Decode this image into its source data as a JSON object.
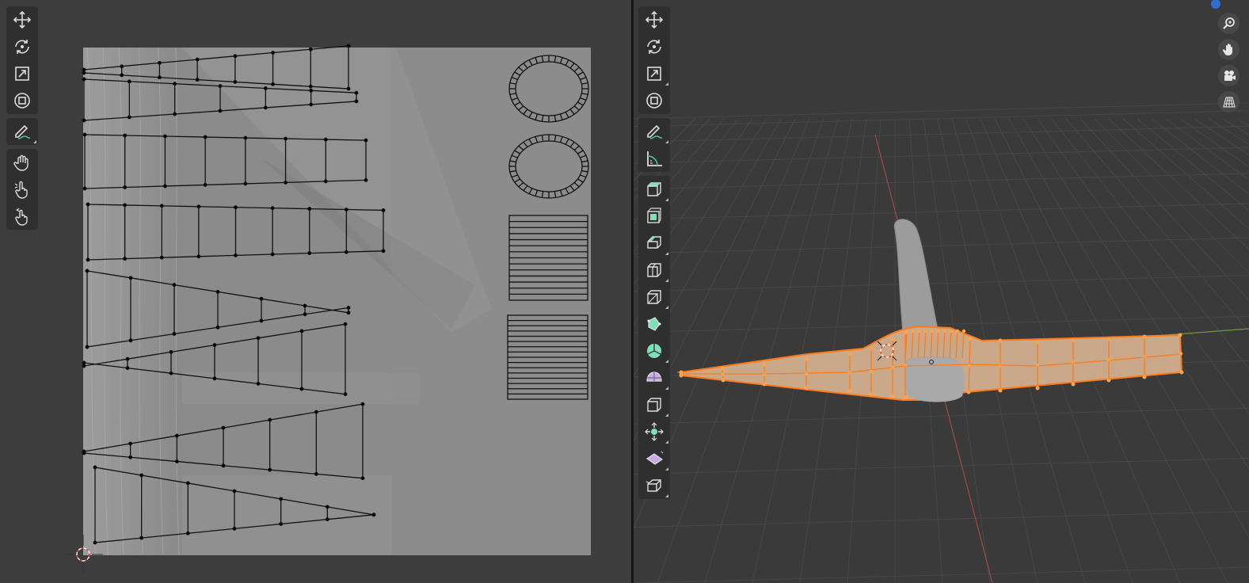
{
  "uv_editor": {
    "tools": [
      {
        "icon": "move-icon",
        "active": false
      },
      {
        "icon": "rotate-icon",
        "active": false
      },
      {
        "icon": "scale-icon",
        "active": false
      },
      {
        "icon": "transform-icon",
        "active": false
      },
      {
        "icon": "annotate-icon",
        "active": false
      },
      {
        "icon": "grab-icon",
        "active": false
      },
      {
        "icon": "relax-icon",
        "active": false
      },
      {
        "icon": "pinch-icon",
        "active": false
      }
    ],
    "texture": "grayscale-wood-texture",
    "cursor": "2d-cursor-icon"
  },
  "viewport_3d": {
    "tools": [
      {
        "icon": "move-icon"
      },
      {
        "icon": "rotate-icon"
      },
      {
        "icon": "scale-icon"
      },
      {
        "icon": "transform-icon"
      },
      {
        "icon": "annotate-icon"
      },
      {
        "icon": "measure-icon"
      },
      {
        "icon": "extrude-region-icon"
      },
      {
        "icon": "inset-faces-icon"
      },
      {
        "icon": "bevel-icon"
      },
      {
        "icon": "loop-cut-icon"
      },
      {
        "icon": "knife-icon"
      },
      {
        "icon": "poly-build-icon"
      },
      {
        "icon": "spin-icon"
      },
      {
        "icon": "smooth-icon"
      },
      {
        "icon": "edge-slide-icon"
      },
      {
        "icon": "shrink-fatten-icon"
      },
      {
        "icon": "shear-icon"
      },
      {
        "icon": "rip-region-icon"
      }
    ],
    "navigation": [
      "zoom-icon",
      "hand-pan-icon",
      "camera-icon",
      "perspective-grid-icon"
    ],
    "colors": {
      "selection": "#ff7a1a",
      "mesh": "#c9a98a",
      "handle": "#9a9a9a",
      "x_axis": "#a04848",
      "y_axis": "#6f9a3a"
    }
  }
}
